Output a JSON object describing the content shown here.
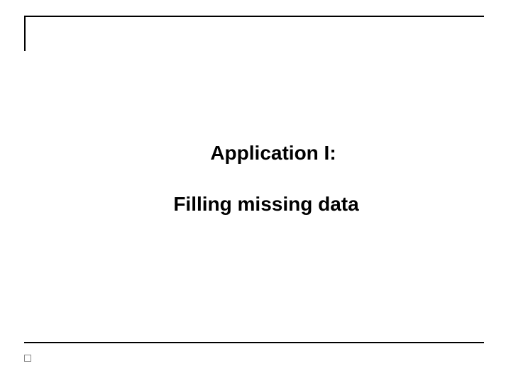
{
  "slide": {
    "title_line1": "Application I:",
    "title_line2": "Filling missing data"
  }
}
